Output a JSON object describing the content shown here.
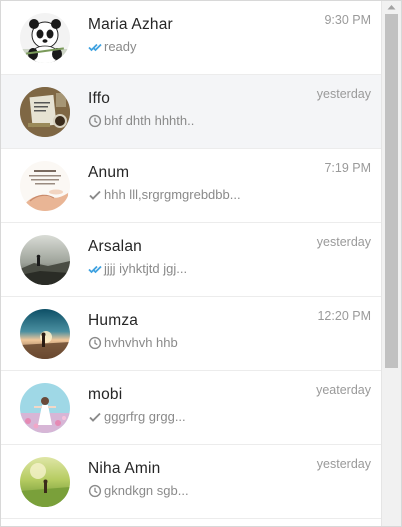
{
  "colors": {
    "tick_blue": "#3fa2e0",
    "tick_grey": "#8a8a8a",
    "active_row": "#f4f5f7"
  },
  "chats": [
    {
      "name": "Maria Azhar",
      "time": "9:30 PM",
      "preview": "ready",
      "status_icon": "double-check-blue-icon",
      "avatar": "panda-avatar"
    },
    {
      "name": "Iffo",
      "time": "yesterday",
      "preview": "bhf dhth hhhth..",
      "status_icon": "clock-icon",
      "avatar": "notebook-coffee-avatar"
    },
    {
      "name": "Anum",
      "time": "7:19 PM",
      "preview": "hhh lll,srgrgmgrebdbb...",
      "status_icon": "check-grey-icon",
      "avatar": "quote-hands-avatar"
    },
    {
      "name": "Arsalan",
      "time": "yesterday",
      "preview": "jjjj iyhktjtd jgj...",
      "status_icon": "double-check-blue-icon",
      "avatar": "person-landscape-avatar"
    },
    {
      "name": "Humza",
      "time": "12:20 PM",
      "preview": "hvhvhvh hhb",
      "status_icon": "clock-icon",
      "avatar": "sunset-avatar"
    },
    {
      "name": "mobi",
      "time": "yeaterday",
      "preview": "gggrfrg grgg...",
      "status_icon": "check-grey-icon",
      "avatar": "girl-flowers-avatar"
    },
    {
      "name": "Niha Amin",
      "time": "yesterday",
      "preview": "gkndkgn sgb...",
      "status_icon": "clock-icon",
      "avatar": "field-avatar"
    }
  ]
}
